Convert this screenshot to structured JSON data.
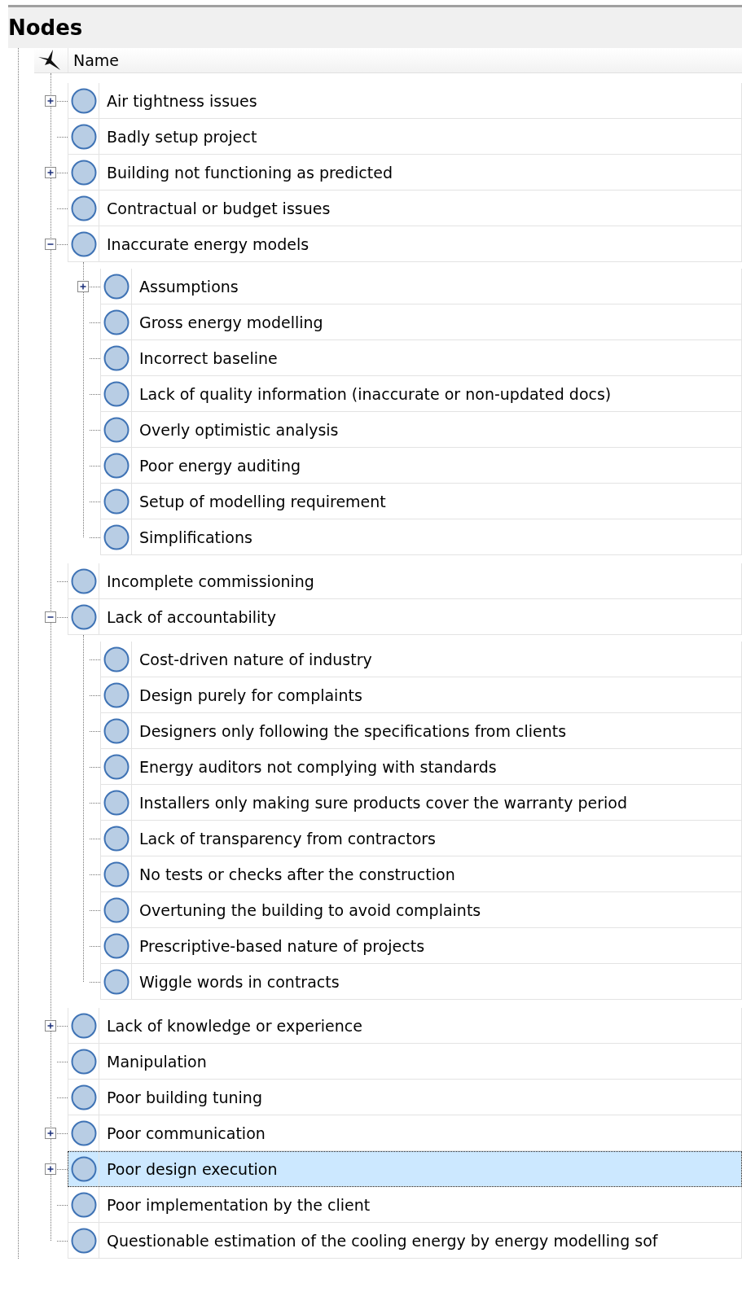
{
  "title": "Nodes",
  "header": {
    "column": "Name"
  },
  "nodes": [
    {
      "label": "Air tightness issues",
      "expanded": false,
      "selected": false
    },
    {
      "label": "Badly setup project",
      "selected": false
    },
    {
      "label": "Building not functioning as predicted",
      "expanded": false,
      "selected": false
    },
    {
      "label": "Contractual or budget issues",
      "selected": false
    },
    {
      "label": "Inaccurate energy models",
      "expanded": true,
      "selected": false,
      "children": [
        {
          "label": "Assumptions",
          "expanded": false,
          "selected": false
        },
        {
          "label": "Gross energy modelling",
          "selected": false
        },
        {
          "label": "Incorrect baseline",
          "selected": false
        },
        {
          "label": "Lack of quality information (inaccurate or non-updated docs)",
          "selected": false
        },
        {
          "label": "Overly optimistic analysis",
          "selected": false
        },
        {
          "label": "Poor energy auditing",
          "selected": false
        },
        {
          "label": "Setup of modelling requirement",
          "selected": false
        },
        {
          "label": "Simplifications",
          "selected": false
        }
      ]
    },
    {
      "label": "Incomplete commissioning",
      "selected": false
    },
    {
      "label": "Lack of accountability",
      "expanded": true,
      "selected": false,
      "children": [
        {
          "label": "Cost-driven nature of industry",
          "selected": false
        },
        {
          "label": "Design purely for complaints",
          "selected": false
        },
        {
          "label": "Designers only following the specifications from clients",
          "selected": false
        },
        {
          "label": "Energy auditors not complying with standards",
          "selected": false
        },
        {
          "label": "Installers only making sure products cover the warranty period",
          "selected": false
        },
        {
          "label": "Lack of transparency from contractors",
          "selected": false
        },
        {
          "label": "No tests or checks after the construction",
          "selected": false
        },
        {
          "label": "Overtuning the building to avoid complaints",
          "selected": false
        },
        {
          "label": "Prescriptive-based nature of projects",
          "selected": false
        },
        {
          "label": "Wiggle words in contracts",
          "selected": false
        }
      ]
    },
    {
      "label": "Lack of knowledge or experience",
      "expanded": false,
      "selected": false
    },
    {
      "label": "Manipulation",
      "selected": false
    },
    {
      "label": "Poor building tuning",
      "selected": false
    },
    {
      "label": "Poor communication",
      "expanded": false,
      "selected": false
    },
    {
      "label": "Poor design execution",
      "expanded": false,
      "selected": true
    },
    {
      "label": "Poor implementation by the client",
      "selected": false
    },
    {
      "label": "Questionable estimation of the cooling energy by energy modelling sof",
      "selected": false
    }
  ]
}
